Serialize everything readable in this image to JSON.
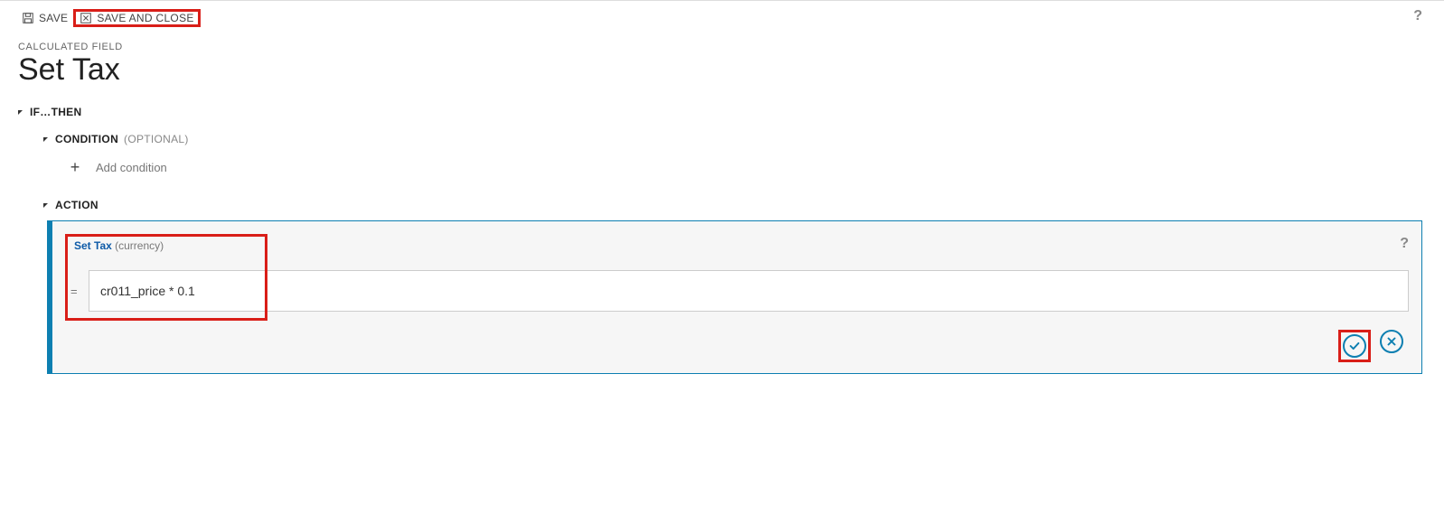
{
  "toolbar": {
    "save_label": "SAVE",
    "save_close_label": "SAVE AND CLOSE"
  },
  "header": {
    "subtitle": "CALCULATED FIELD",
    "title": "Set Tax"
  },
  "ifthen": {
    "label": "IF…THEN",
    "condition": {
      "label": "CONDITION",
      "optional": "(OPTIONAL)",
      "add_label": "Add condition"
    },
    "action": {
      "label": "ACTION",
      "set_label": "Set Tax",
      "type": "(currency)",
      "formula": "cr011_price * 0.1"
    }
  }
}
